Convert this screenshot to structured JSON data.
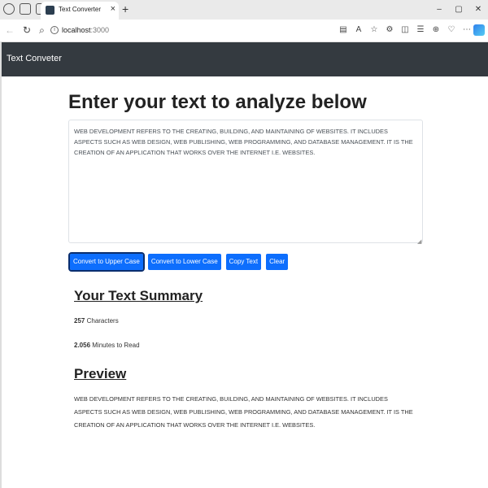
{
  "browser": {
    "tab_title": "Text Converter",
    "new_tab": "+",
    "url_host": "localhost",
    "url_port": ":3000",
    "window_controls": [
      "–",
      "▢",
      "✕"
    ]
  },
  "navbar": {
    "brand": "Text Conveter"
  },
  "main": {
    "heading": "Enter your text to analyze below",
    "text_value": "WEB DEVELOPMENT REFERS TO THE CREATING, BUILDING, AND MAINTAINING OF WEBSITES. IT INCLUDES ASPECTS SUCH AS WEB DESIGN, WEB PUBLISHING, WEB PROGRAMMING, AND DATABASE MANAGEMENT. IT IS THE CREATION OF AN APPLICATION THAT WORKS OVER THE INTERNET I.E. WEBSITES.",
    "buttons": {
      "upper": "Convert to Upper Case",
      "lower": "Convert to Lower Case",
      "copy": "Copy Text",
      "clear": "Clear"
    }
  },
  "summary": {
    "title": "Your Text Summary",
    "characters_count": "257",
    "characters_label": "Characters",
    "minutes_count": "2.056",
    "minutes_label": "Minutes to Read"
  },
  "preview": {
    "title": "Preview",
    "text": "WEB DEVELOPMENT REFERS TO THE CREATING, BUILDING, AND MAINTAINING OF WEBSITES. IT INCLUDES ASPECTS SUCH AS WEB DESIGN, WEB PUBLISHING, WEB PROGRAMMING, AND DATABASE MANAGEMENT. IT IS THE CREATION OF AN APPLICATION THAT WORKS OVER THE INTERNET I.E. WEBSITES."
  },
  "colors": {
    "primary": "#0d6efd",
    "navbar": "#343a40"
  }
}
